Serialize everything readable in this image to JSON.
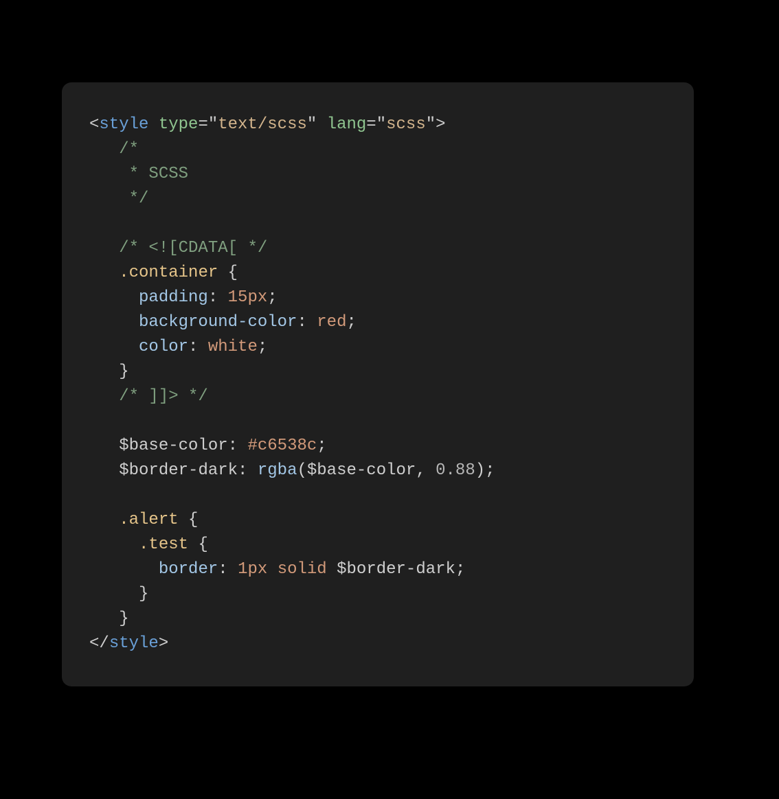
{
  "code": {
    "l1": {
      "lt": "<",
      "tag": "style",
      "sp": " ",
      "attr1": "type",
      "eq": "=",
      "q": "\"",
      "str1": "text/scss",
      "sp2": " ",
      "attr2": "lang",
      "str2": "scss",
      "gt": ">"
    },
    "l2": "   /*",
    "l3": "    * SCSS",
    "l4": "    */",
    "l5": "",
    "l6": "   /* <![CDATA[ */",
    "l7": {
      "ind": "   ",
      "sel": ".container",
      "sp": " ",
      "brace": "{"
    },
    "l8": {
      "ind": "     ",
      "prop": "padding",
      "col": ": ",
      "val": "15px",
      "sc": ";"
    },
    "l9": {
      "ind": "     ",
      "prop": "background-color",
      "col": ": ",
      "val": "red",
      "sc": ";"
    },
    "l10": {
      "ind": "     ",
      "prop": "color",
      "col": ": ",
      "val": "white",
      "sc": ";"
    },
    "l11": "   }",
    "l12": "   /* ]]> */",
    "l13": "",
    "l14": {
      "ind": "   ",
      "var": "$base-color",
      "col": ": ",
      "val": "#c6538c",
      "sc": ";"
    },
    "l15": {
      "ind": "   ",
      "var": "$border-dark",
      "col": ": ",
      "fn": "rgba",
      "op1": "(",
      "arg1": "$base-color",
      "comma": ", ",
      "arg2": "0.88",
      "op2": ")",
      "sc": ";"
    },
    "l16": "",
    "l17": {
      "ind": "   ",
      "sel": ".alert",
      "sp": " ",
      "brace": "{"
    },
    "l18": {
      "ind": "     ",
      "sel": ".test",
      "sp": " ",
      "brace": "{"
    },
    "l19": {
      "ind": "       ",
      "prop": "border",
      "col": ": ",
      "val1": "1px",
      "sp1": " ",
      "val2": "solid",
      "sp2": " ",
      "val3": "$border-dark",
      "sc": ";"
    },
    "l20": "     }",
    "l21": "   }",
    "l22": {
      "lt": "</",
      "tag": "style",
      "gt": ">"
    }
  }
}
